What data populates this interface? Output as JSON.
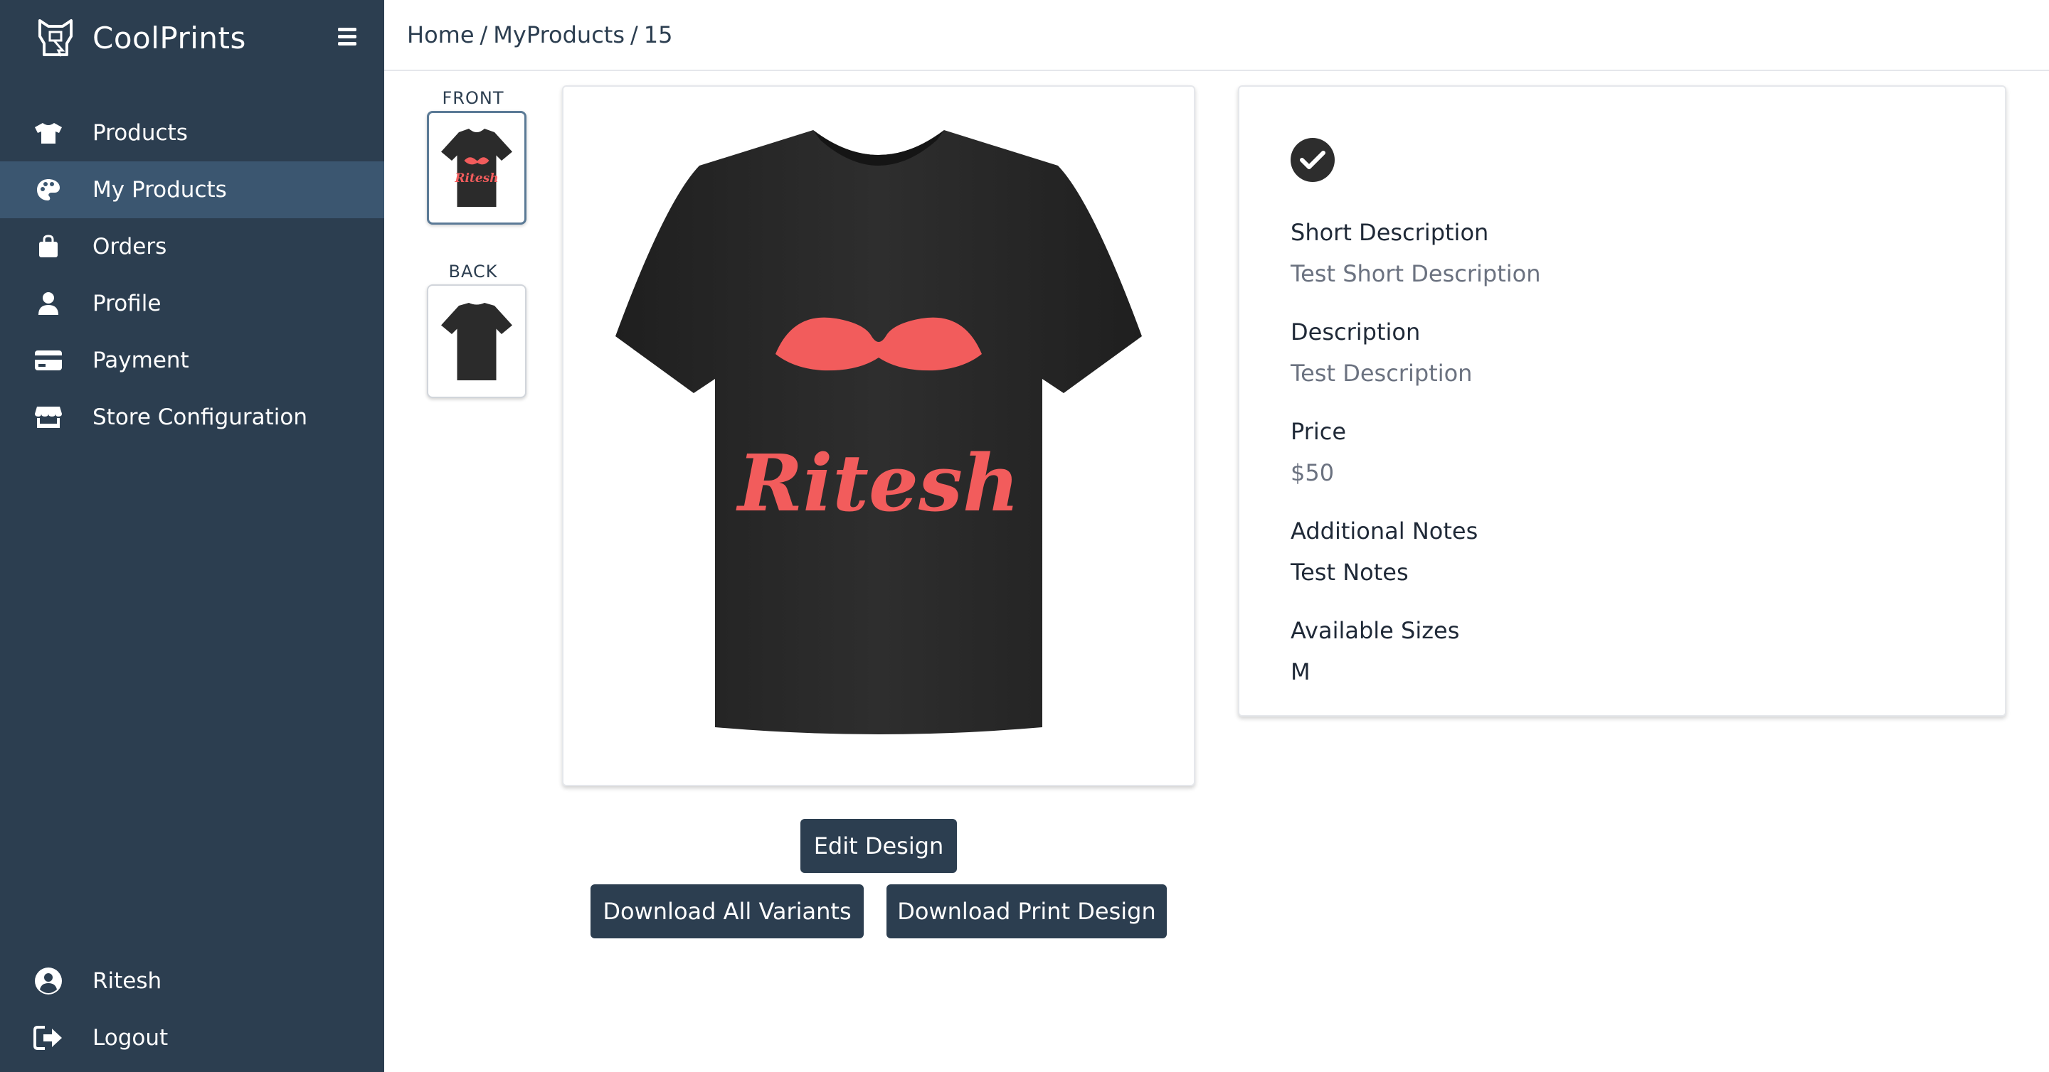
{
  "app": {
    "name": "CoolPrints"
  },
  "sidebar": {
    "items": [
      {
        "label": "Products",
        "icon": "shirt-icon"
      },
      {
        "label": "My Products",
        "icon": "palette-icon",
        "active": true
      },
      {
        "label": "Orders",
        "icon": "shopping-bag-icon"
      },
      {
        "label": "Profile",
        "icon": "user-icon"
      },
      {
        "label": "Payment",
        "icon": "credit-card-icon"
      },
      {
        "label": "Store Configuration",
        "icon": "store-icon"
      }
    ],
    "bottom": [
      {
        "label": "Ritesh",
        "icon": "user-circle-icon"
      },
      {
        "label": "Logout",
        "icon": "logout-icon"
      }
    ]
  },
  "breadcrumb": {
    "home": "Home",
    "section": "MyProducts",
    "id": "15",
    "separator": "/"
  },
  "views": {
    "front_label": "FRONT",
    "back_label": "BACK"
  },
  "design": {
    "print_text": "Ritesh",
    "shirt_color": "#2b2b2b",
    "print_color": "#f25c5c"
  },
  "actions": {
    "edit": "Edit Design",
    "download_all": "Download All Variants",
    "download_print": "Download Print Design"
  },
  "details": {
    "short_description_label": "Short Description",
    "short_description_value": "Test Short Description",
    "description_label": "Description",
    "description_value": "Test Description",
    "price_label": "Price",
    "price_value": "$50",
    "notes_label": "Additional Notes",
    "notes_value": "Test Notes",
    "sizes_label": "Available Sizes",
    "sizes_value": "M"
  },
  "colors": {
    "sidebar_bg": "#2c3e50",
    "sidebar_active": "#3b5670",
    "button_bg": "#2c3e50"
  }
}
